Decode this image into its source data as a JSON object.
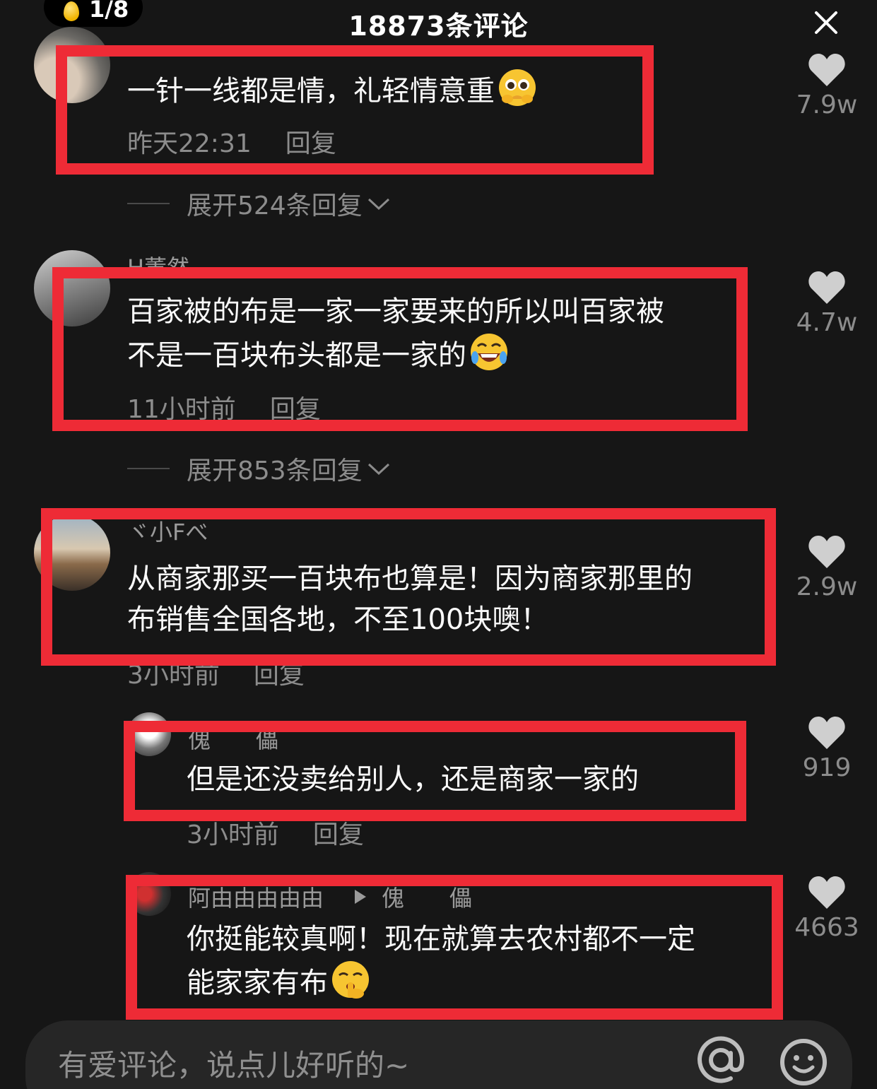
{
  "header": {
    "pager": "1/8",
    "title": "18873条评论",
    "close_icon": "close-icon"
  },
  "comments": [
    {
      "text": "一针一线都是情，礼轻情意重",
      "emoji": "pleading-face-icon",
      "time": "昨天22:31",
      "reply": "回复",
      "expand": "展开524条回复",
      "likes": "7.9w"
    },
    {
      "username": "H董然",
      "text_line1": "百家被的布是一家一家要来的所以叫百家被",
      "text_line2": "不是一百块布头都是一家的",
      "emoji": "rolling-laughing-icon",
      "time": "11小时前",
      "reply": "回复",
      "expand": "展开853条回复",
      "likes": "4.7w"
    },
    {
      "username": "ヾ小Fべ",
      "text_line1": "从商家那买一百块布也算是！因为商家那里的",
      "text_line2": "布销售全国各地，不至100块噢！",
      "time": "3小时前",
      "reply": "回复",
      "likes": "2.9w"
    },
    {
      "username": "傀　　儡",
      "text": "但是还没卖给别人，还是商家一家的",
      "time": "3小时前",
      "reply": "回复",
      "likes": "919"
    },
    {
      "username": "阿由由由由由",
      "reply_to": "傀　　儡",
      "text_line1": "你挺能较真啊！现在就算去农村都不一定",
      "text_line2": "能家家有布",
      "emoji": "shushing-face-icon",
      "likes": "4663"
    }
  ],
  "input": {
    "placeholder": "有爱评论，说点儿好听的~",
    "at_icon": "at-icon",
    "emoji_icon": "smile-icon"
  },
  "colors": {
    "background": "#161616",
    "highlight": "#ee2b36",
    "muted_text": "#8c8c8c"
  }
}
